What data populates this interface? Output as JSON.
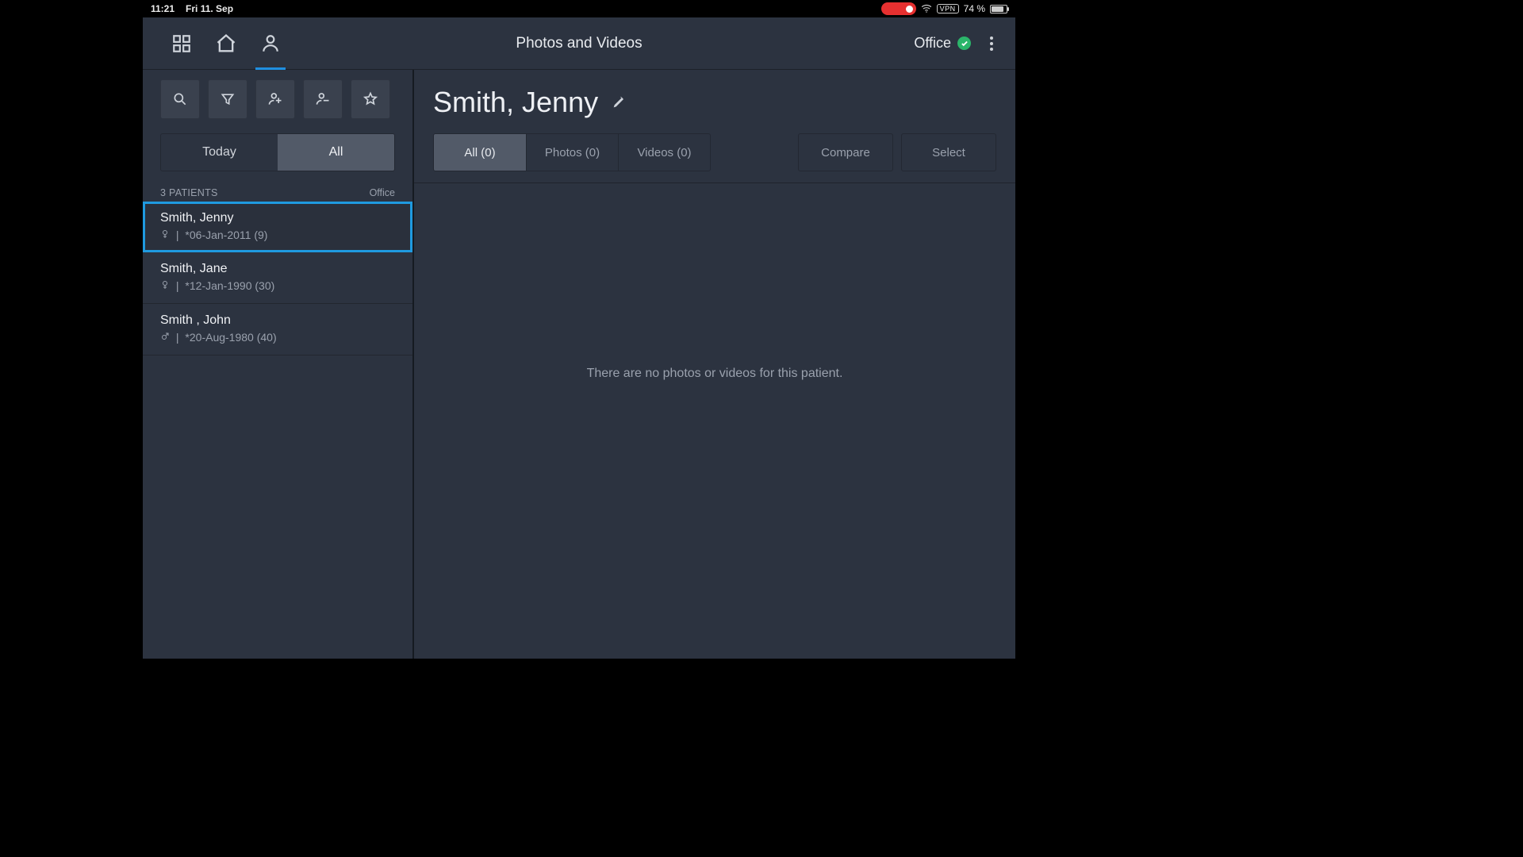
{
  "status_bar": {
    "time": "11:21",
    "date": "Fri 11. Sep",
    "vpn": "VPN",
    "battery_text": "74 %"
  },
  "header": {
    "title": "Photos and Videos",
    "location_label": "Office"
  },
  "sidebar": {
    "segments": {
      "today": "Today",
      "all": "All"
    },
    "list_header": {
      "count_label": "3 PATIENTS",
      "location": "Office"
    },
    "patients": [
      {
        "name": "Smith, Jenny",
        "gender": "female",
        "meta": "*06-Jan-2011 (9)",
        "selected": true
      },
      {
        "name": "Smith, Jane",
        "gender": "female",
        "meta": "*12-Jan-1990 (30)",
        "selected": false
      },
      {
        "name": "Smith , John",
        "gender": "male",
        "meta": "*20-Aug-1980 (40)",
        "selected": false
      }
    ]
  },
  "main": {
    "patient_name": "Smith, Jenny",
    "tabs": {
      "all": "All (0)",
      "photos": "Photos (0)",
      "videos": "Videos (0)"
    },
    "actions": {
      "compare": "Compare",
      "select": "Select"
    },
    "empty_message": "There are no photos or videos for this patient."
  }
}
